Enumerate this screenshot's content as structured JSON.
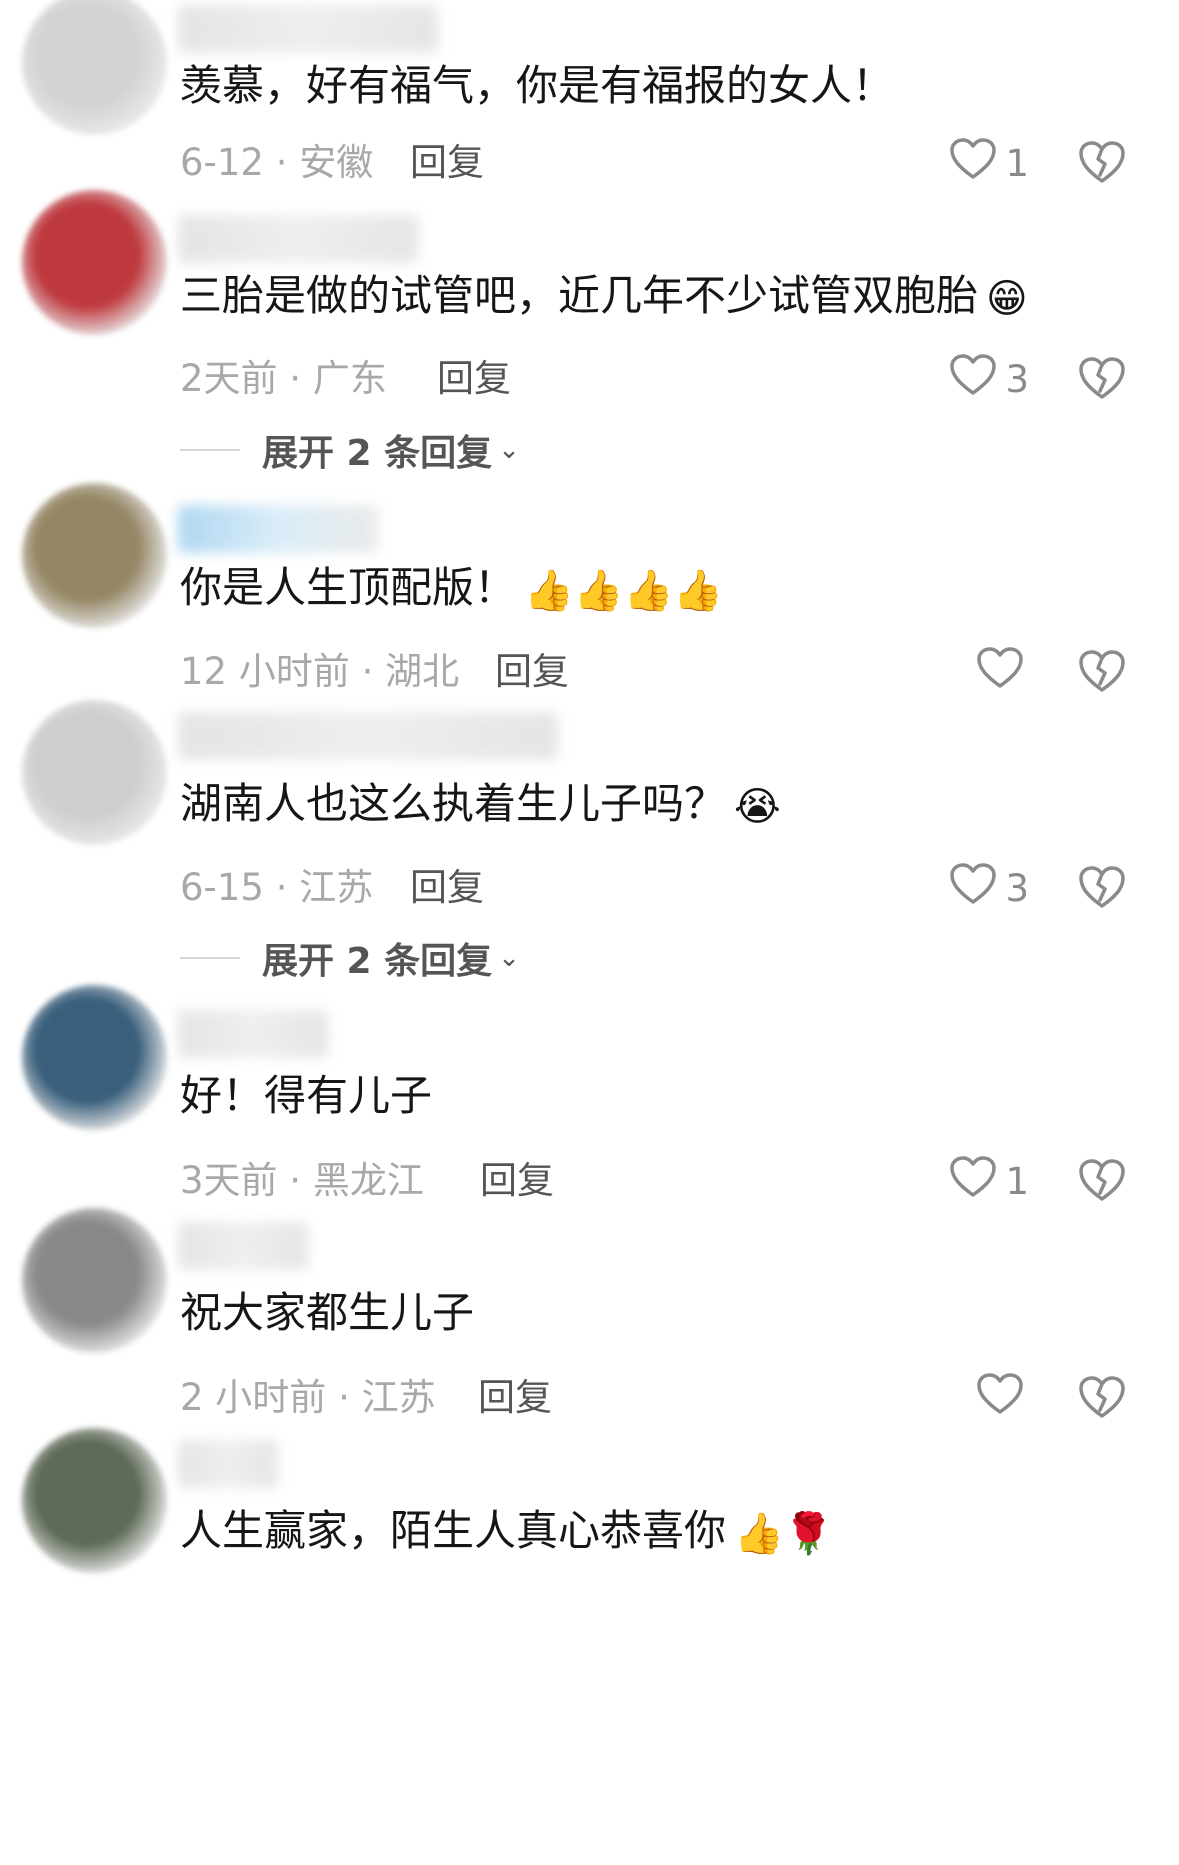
{
  "comments": [
    {
      "text": "羡慕，好有福气，你是有福报的女人！",
      "emoji": "",
      "meta": "6-12 · 安徽",
      "reply_label": "回复",
      "likes": "1",
      "avatar_color": "#cfcfcf",
      "expand_label": ""
    },
    {
      "text": "三胎是做的试管吧，近几年不少试管双胞胎",
      "emoji": "😁",
      "meta": "2天前 · 广东",
      "reply_label": "回复",
      "likes": "3",
      "avatar_color": "#b8242a",
      "expand_label": "展开 2 条回复"
    },
    {
      "text": "你是人生顶配版！",
      "emoji": "👍👍👍👍",
      "meta": "12 小时前 · 湖北",
      "reply_label": "回复",
      "likes": "",
      "avatar_color": "#8a7a55",
      "expand_label": ""
    },
    {
      "text": "湖南人也这么执着生儿子吗？",
      "emoji": "😭",
      "meta": "6-15 · 江苏",
      "reply_label": "回复",
      "likes": "3",
      "avatar_color": "#c9c9c9",
      "expand_label": "展开 2 条回复"
    },
    {
      "text": "好！得有儿子",
      "emoji": "",
      "meta": "3天前 · 黑龙江",
      "reply_label": "回复",
      "likes": "1",
      "avatar_color": "#244e6e",
      "expand_label": ""
    },
    {
      "text": "祝大家都生儿子",
      "emoji": "",
      "meta": "2 小时前 · 江苏",
      "reply_label": "回复",
      "likes": "",
      "avatar_color": "#7d7d7d",
      "expand_label": ""
    },
    {
      "text": "人生赢家，陌生人真心恭喜你",
      "emoji": "👍🌹",
      "meta": "",
      "reply_label": "",
      "likes": "",
      "avatar_color": "#4d5b45",
      "expand_label": ""
    }
  ],
  "icons": {
    "like": "heart-outline-icon",
    "dislike": "broken-heart-icon",
    "expand": "chevron-down-icon"
  },
  "colors": {
    "meta_text": "#a8a8a8",
    "icon_stroke": "#8a8a8a"
  }
}
